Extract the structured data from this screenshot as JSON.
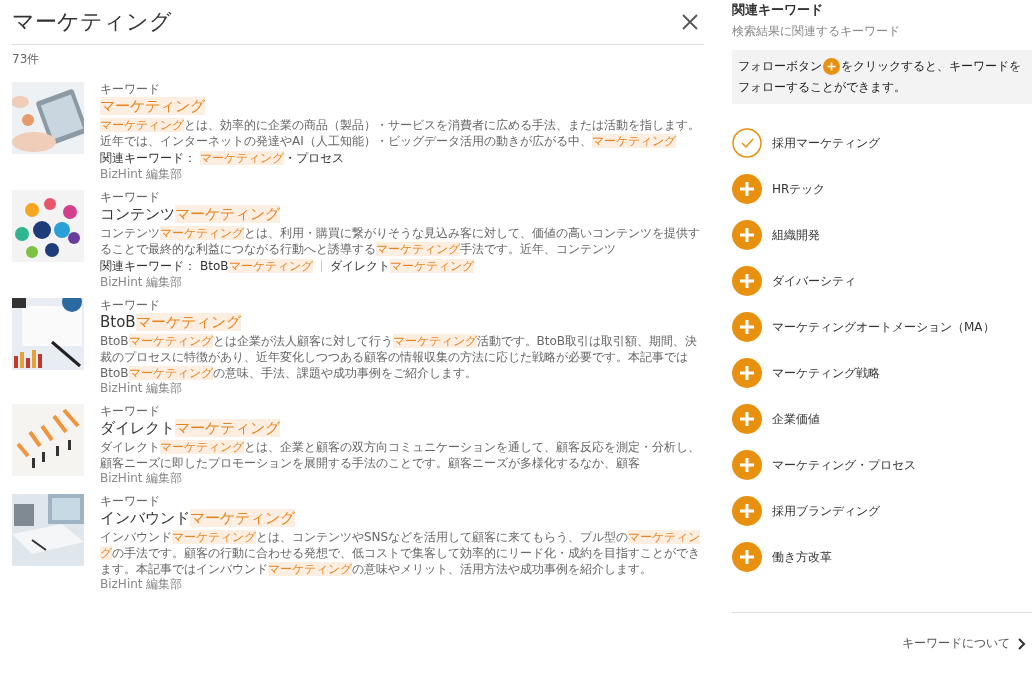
{
  "header": {
    "title": "マーケティング",
    "count": "73件"
  },
  "results": [
    {
      "label": "キーワード",
      "title": "**マーケティング**",
      "description": "**マーケティング**とは、効率的に企業の商品（製品）・サービスを消費者に広める手法、または活動を指します。近年では、インターネットの発達やAI（人工知能）・ビッグデータ活用の動きが広がる中、**マーケティング**",
      "related": {
        "label": "関連キーワード：",
        "links": [
          "**マーケティング**・プロセス"
        ]
      },
      "author": "BizHint 編集部"
    },
    {
      "label": "キーワード",
      "title": "コンテンツ**マーケティング**",
      "description": "コンテンツ**マーケティング**とは、利用・購買に繋がりそうな見込み客に対して、価値の高いコンテンツを提供することで最終的な利益につながる行動へと誘導する**マーケティング**手法です。近年、コンテンツ",
      "related": {
        "label": "関連キーワード：",
        "links": [
          "BtoB**マーケティング**",
          "ダイレクト**マーケティング**"
        ]
      },
      "author": "BizHint 編集部"
    },
    {
      "label": "キーワード",
      "title": "BtoB**マーケティング**",
      "description": "BtoB**マーケティング**とは企業が法人顧客に対して行う**マーケティング**活動です。BtoB取引は取引額、期間、決裁のプロセスに特徴があり、近年変化しつつある顧客の情報収集の方法に応じた戦略が必要です。本記事ではBtoB**マーケティング**の意味、手法、課題や成功事例をご紹介します。",
      "author": "BizHint 編集部"
    },
    {
      "label": "キーワード",
      "title": "ダイレクト**マーケティング**",
      "description": "ダイレクト**マーケティング**とは、企業と顧客の双方向コミュニケーションを通して、顧客反応を測定・分析し、顧客ニーズに即したプロモーションを展開する手法のことです。顧客ニーズが多様化するなか、顧客",
      "author": "BizHint 編集部"
    },
    {
      "label": "キーワード",
      "title": "インバウンド**マーケティング**",
      "description": "インバウンド**マーケティング**とは、コンテンツやSNSなどを活用して顧客に来てもらう、プル型の**マーケティング**の手法です。顧客の行動に合わせる発想で、低コストで集客して効率的にリード化・成約を目指すことができます。本記事ではインバウンド**マーケティング**の意味やメリット、活用方法や成功事例を紹介します。",
      "author": "BizHint 編集部"
    }
  ],
  "sidebar": {
    "title": "関連キーワード",
    "subtitle": "検索結果に関連するキーワード",
    "hint": {
      "before": "フォローボタン",
      "after": "をクリックすると、キーワードを",
      "line_2": "フォローすることができます。"
    },
    "keywords": [
      {
        "label": "採用マーケティング",
        "followed": true
      },
      {
        "label": "HRテック",
        "followed": false
      },
      {
        "label": "組織開発",
        "followed": false
      },
      {
        "label": "ダイバーシティ",
        "followed": false
      },
      {
        "label": "マーケティングオートメーション（MA）",
        "followed": false
      },
      {
        "label": "マーケティング戦略",
        "followed": false
      },
      {
        "label": "企業価値",
        "followed": false
      },
      {
        "label": "マーケティング・プロセス",
        "followed": false
      },
      {
        "label": "採用ブランディング",
        "followed": false
      },
      {
        "label": "働き方改革",
        "followed": false
      }
    ],
    "footer_link": "キーワードについて"
  }
}
